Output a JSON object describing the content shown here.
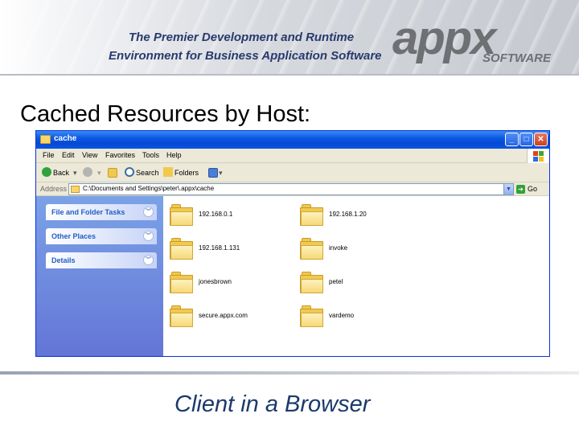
{
  "banner": {
    "tagline_line1": "The Premier Development and Runtime",
    "tagline_line2": "Environment for Business Application Software",
    "logo_word": "appx",
    "logo_sub": "SOFTWARE"
  },
  "slide": {
    "title": "Cached Resources by Host:",
    "footer": "Client in a Browser"
  },
  "window": {
    "title": "cache",
    "controls": {
      "minimize": "_",
      "maximize": "□",
      "close": "✕"
    },
    "menu": [
      "File",
      "Edit",
      "View",
      "Favorites",
      "Tools",
      "Help"
    ],
    "toolbar": {
      "back": "Back",
      "search": "Search",
      "folders": "Folders"
    },
    "address": {
      "label": "Address",
      "value": "C:\\Documents and Settings\\peter\\.appx\\cache",
      "go": "Go"
    },
    "task_groups": [
      "File and Folder Tasks",
      "Other Places",
      "Details"
    ],
    "folders": [
      "192.168.0.1",
      "192.168.1.20",
      "192.168.1.131",
      "invoke",
      "jonesbrown",
      "petel",
      "secure.appx.com",
      "vardemo"
    ]
  },
  "colors": {
    "xp_title_blue": "#0a58e3",
    "task_pane_blue": "#6375d6",
    "tagline_navy": "#283a6e",
    "footer_blue": "#1b3a6b",
    "folder_yellow": "#f1c94f"
  },
  "icons": {
    "back": "back-arrow-icon",
    "forward": "forward-arrow-icon",
    "up": "up-folder-icon",
    "search": "search-icon",
    "folders": "folders-icon",
    "views": "views-icon",
    "go": "go-arrow-icon"
  }
}
